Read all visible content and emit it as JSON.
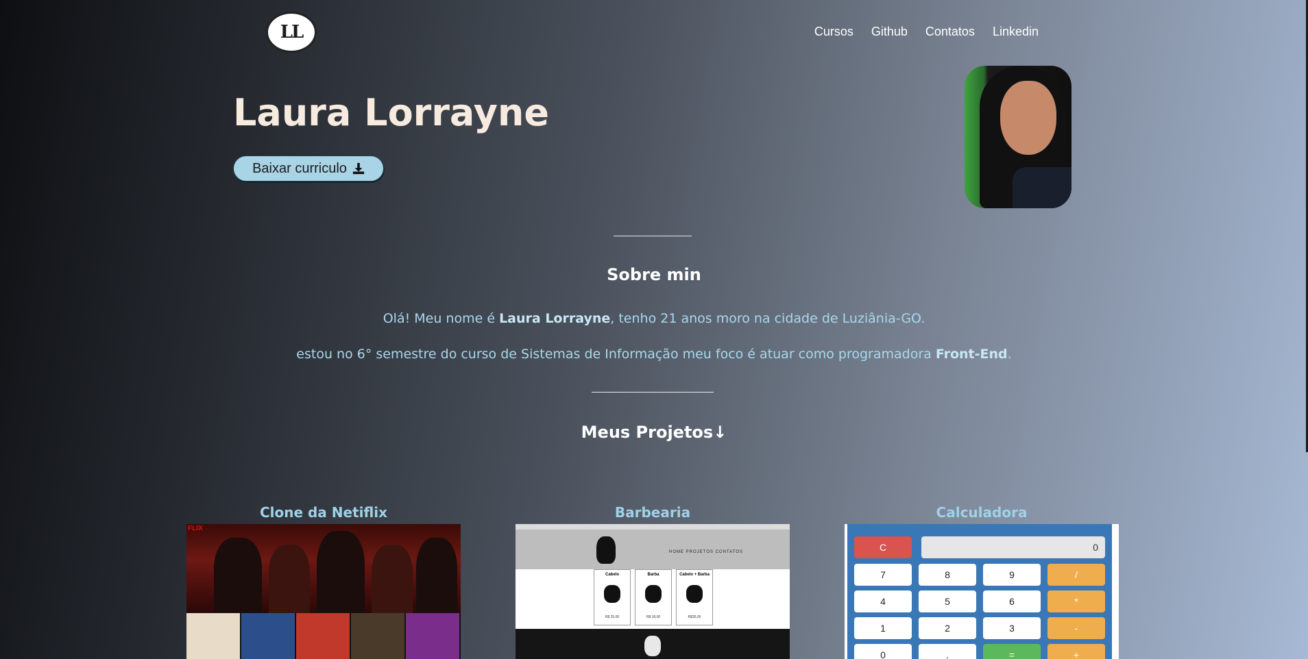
{
  "header": {
    "logo_text": "LL",
    "nav": [
      "Cursos",
      "Github",
      "Contatos",
      "Linkedin"
    ]
  },
  "hero": {
    "name": "Laura Lorrayne",
    "cv_button": "Baixar curriculo",
    "download_icon": "download-icon"
  },
  "about": {
    "title": "Sobre min",
    "p1_pre": "Olá! Meu nome é ",
    "p1_name": "Laura Lorrayne",
    "p1_post": ", tenho 21 anos moro na cidade de Luziânia-GO.",
    "p2_pre": "estou no 6° semestre do curso de Sistemas de Informação meu foco é atuar como programadora ",
    "p2_bold": "Front-End",
    "p2_post": "."
  },
  "projects": {
    "title": "Meus Projetos↓",
    "items": [
      {
        "title": "Clone da Netiflix",
        "logo": "FLIX"
      },
      {
        "title": "Barbearia",
        "nav": "HOME  PROJETOS  CONTATOS",
        "cards": [
          {
            "title": "Cabelo",
            "price": "R$ 25,00"
          },
          {
            "title": "Barba",
            "price": "R$ 18,00"
          },
          {
            "title": "Cabelo + Barba",
            "price": "R$35,00"
          }
        ]
      },
      {
        "title": "Calculadora",
        "display": "0",
        "buttons": [
          "C",
          "7",
          "8",
          "9",
          "/",
          "4",
          "5",
          "6",
          "*",
          "1",
          "2",
          "3",
          "-",
          "0",
          ".",
          "=",
          "+"
        ]
      }
    ]
  },
  "colors": {
    "accent": "#a8d4e6",
    "name": "#f7ebe0",
    "link": "#9fd2e8"
  }
}
